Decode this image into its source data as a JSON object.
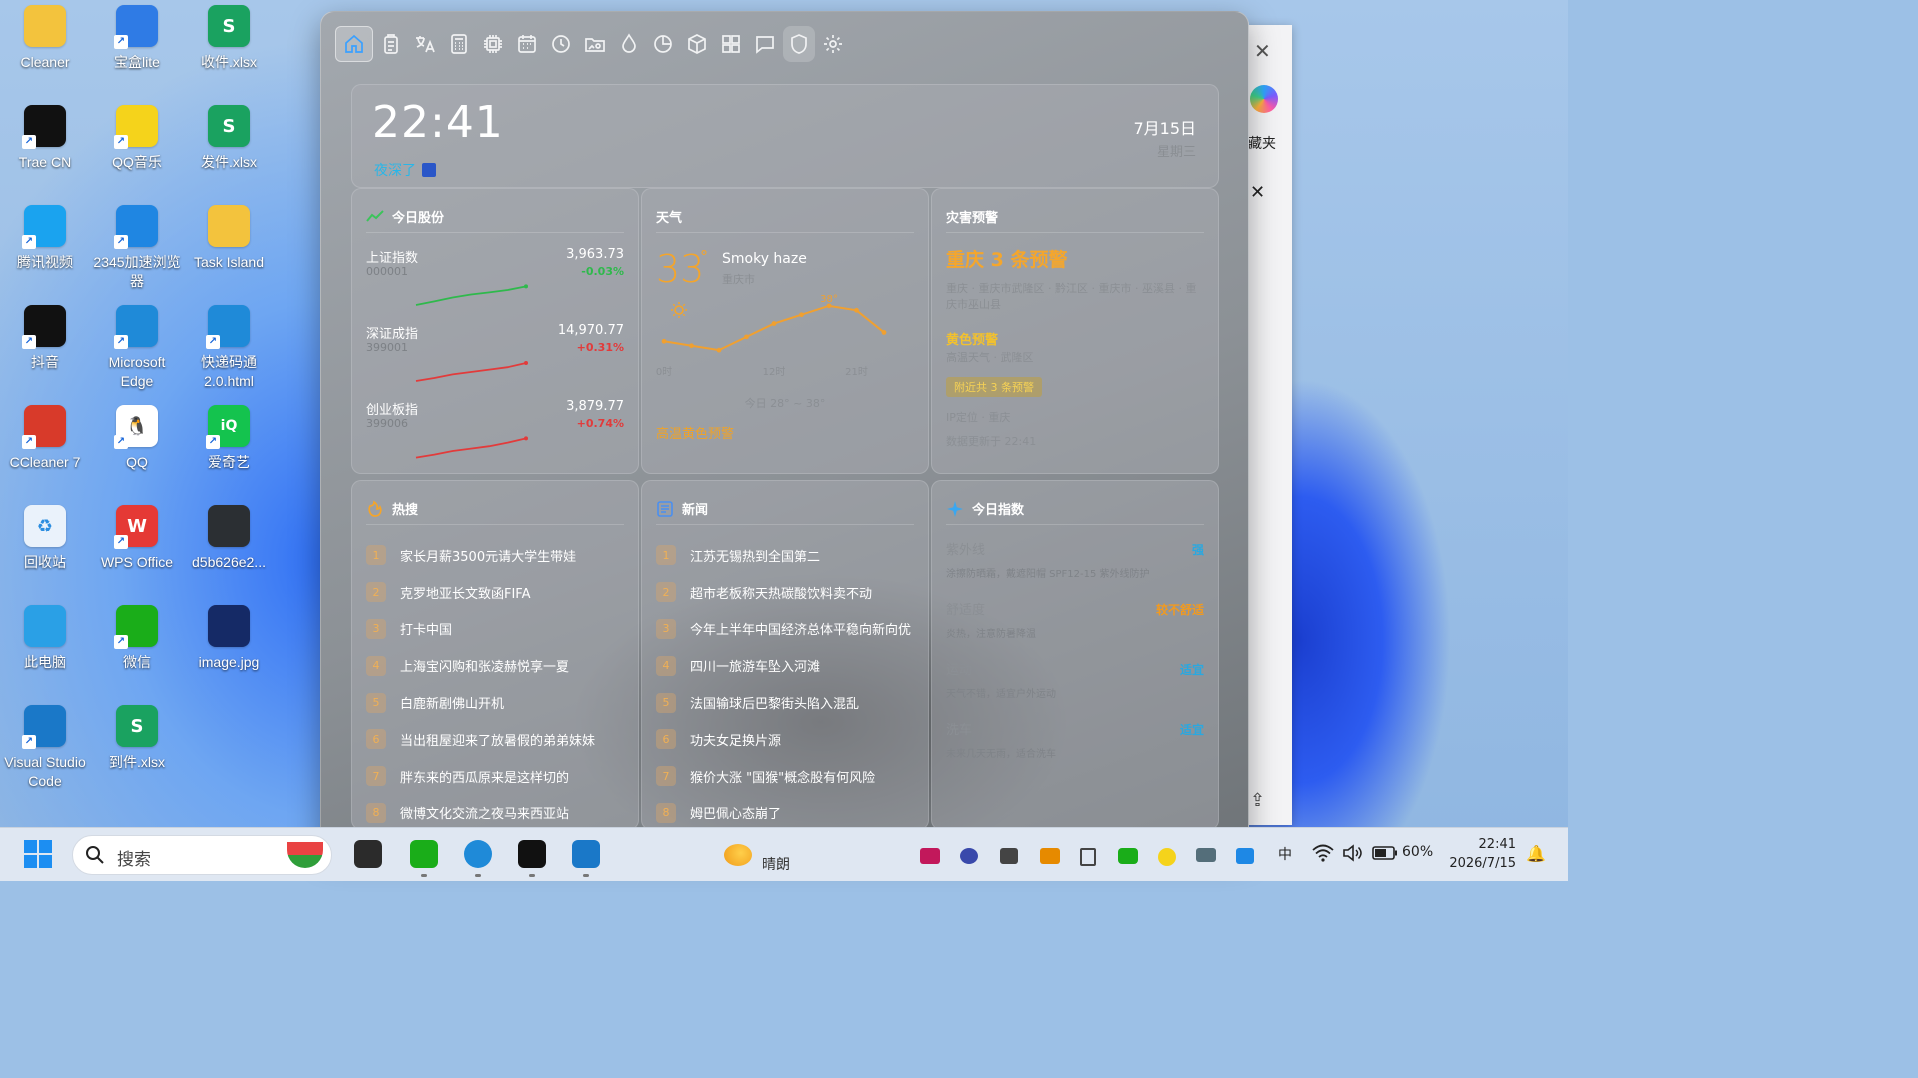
{
  "desktop": {
    "icons": [
      {
        "label": "Cleaner",
        "icon": "folder-icon",
        "color": "#f3c33d"
      },
      {
        "label": "宝盒lite",
        "icon": "shield-app-icon",
        "color": "#2f7be5"
      },
      {
        "label": "收件.xlsx",
        "icon": "spreadsheet-icon",
        "color": "#1aa260"
      },
      {
        "label": "Trae CN",
        "icon": "trae-icon",
        "color": "#111111"
      },
      {
        "label": "QQ音乐",
        "icon": "music-icon",
        "color": "#f5d31b"
      },
      {
        "label": "发件.xlsx",
        "icon": "spreadsheet-icon",
        "color": "#1aa260"
      },
      {
        "label": "腾讯视频",
        "icon": "video-play-icon",
        "color": "#1aa3ef"
      },
      {
        "label": "2345加速浏览器",
        "icon": "browser-icon",
        "color": "#1f86e2"
      },
      {
        "label": "Task Island",
        "icon": "folder-icon",
        "color": "#f3c33d"
      },
      {
        "label": "抖音",
        "icon": "tiktok-icon",
        "color": "#111111"
      },
      {
        "label": "Microsoft Edge",
        "icon": "edge-icon",
        "color": "#1f8ad8"
      },
      {
        "label": "快递码通2.0.html",
        "icon": "edge-icon",
        "color": "#1f8ad8"
      },
      {
        "label": "CCleaner 7",
        "icon": "ccleaner-icon",
        "color": "#d83a2a"
      },
      {
        "label": "QQ",
        "icon": "penguin-icon",
        "color": "#ffffff"
      },
      {
        "label": "爱奇艺",
        "icon": "iqiyi-icon",
        "color": "#14c34e"
      },
      {
        "label": "回收站",
        "icon": "recycle-bin-icon",
        "color": "#eaf2fb"
      },
      {
        "label": "WPS Office",
        "icon": "wps-icon",
        "color": "#e53935"
      },
      {
        "label": "d5b626e2...",
        "icon": "file-icon",
        "color": "#2b2f33"
      },
      {
        "label": "此电脑",
        "icon": "computer-icon",
        "color": "#2aa0e6"
      },
      {
        "label": "微信",
        "icon": "wechat-icon",
        "color": "#1aad19"
      },
      {
        "label": "image.jpg",
        "icon": "image-icon",
        "color": "#152a66"
      },
      {
        "label": "Visual Studio Code",
        "icon": "vscode-icon",
        "color": "#1a78c8"
      },
      {
        "label": "到件.xlsx",
        "icon": "spreadsheet-icon",
        "color": "#1aa260"
      }
    ]
  },
  "backwin": {
    "text": "藏夹"
  },
  "toolbar": {
    "icons": [
      "home-icon",
      "clipboard-icon",
      "translate-icon",
      "calculator-icon",
      "chip-icon",
      "calendar-icon",
      "clock-icon",
      "image-folder-icon",
      "water-drop-icon",
      "pie-chart-icon",
      "cube-icon",
      "grid-icon",
      "chat-icon",
      "shield-icon",
      "settings-icon"
    ]
  },
  "clock": {
    "time": "22:41",
    "greeting": "夜深了",
    "date": "7月15日",
    "weekday": "星期三"
  },
  "stocks": {
    "title": "今日股份",
    "items": [
      {
        "name": "上证指数",
        "code": "000001",
        "value": "3,963.73",
        "change": "-0.03%",
        "color": "#2fb94c",
        "trend": [
          0.2,
          0.32,
          0.45,
          0.55,
          0.62,
          0.7,
          0.82
        ]
      },
      {
        "name": "深证成指",
        "code": "399001",
        "value": "14,970.77",
        "change": "+0.31%",
        "color": "#e23b3b",
        "trend": [
          0.2,
          0.3,
          0.42,
          0.5,
          0.58,
          0.66,
          0.8
        ]
      },
      {
        "name": "创业板指",
        "code": "399006",
        "value": "3,879.77",
        "change": "+0.74%",
        "color": "#e23b3b",
        "trend": [
          0.18,
          0.28,
          0.4,
          0.48,
          0.56,
          0.68,
          0.82
        ]
      }
    ]
  },
  "weather": {
    "title": "天气",
    "temp": "33",
    "deg": "°",
    "condition": "Smoky haze",
    "city": "重庆市",
    "peak_label": "38°",
    "x_labels": [
      "0时",
      "12时",
      "21时"
    ],
    "hourly": [
      30,
      29,
      28,
      31,
      34,
      36,
      38,
      37,
      32
    ],
    "range": "今日 28° ~ 38°",
    "alert": "高温黄色预警"
  },
  "warning": {
    "title": "灾害预警",
    "headline": "重庆 3 条预警",
    "desc": "重庆 · 重庆市武隆区 · 黔江区 · 重庆市 · 巫溪县 · 重庆市巫山县",
    "level": "黄色预警",
    "level_sub": "高温天气 · 武隆区",
    "nearby": "附近共 3 条预警",
    "source": "IP定位 · 重庆",
    "updated": "数据更新于 22:41"
  },
  "hot": {
    "title": "热搜",
    "items": [
      "家长月薪3500元请大学生带娃",
      "克罗地亚长文致函FIFA",
      "打卡中国",
      "上海宝闪购和张凌赫悦享一夏",
      "白鹿新剧佛山开机",
      "当出租屋迎来了放暑假的弟弟妹妹",
      "胖东来的西瓜原来是这样切的",
      "微博文化交流之夜马来西亚站"
    ]
  },
  "news": {
    "title": "新闻",
    "items": [
      "江苏无锡热到全国第二",
      "超市老板称天热碳酸饮料卖不动",
      "今年上半年中国经济总体平稳向新向优",
      "四川一旅游车坠入河滩",
      "法国输球后巴黎街头陷入混乱",
      "功夫女足换片源",
      "猴价大涨 \"国猴\"概念股有何风险",
      "姆巴佩心态崩了"
    ]
  },
  "indices": {
    "title": "今日指数",
    "items": [
      {
        "name": "紫外线",
        "value": "强",
        "desc": "涂擦防晒霜，戴遮阳帽 SPF12-15 紫外线防护",
        "color": "#2aa8e0"
      },
      {
        "name": "舒适度",
        "value": "较不舒适",
        "desc": "炎热，注意防暑降温",
        "color": "#f29a1f"
      },
      {
        "name": "运动",
        "value": "适宜",
        "desc": "天气不错，适宜户外运动",
        "color": "#2aa8e0"
      },
      {
        "name": "洗车",
        "value": "适宜",
        "desc": "未来几天无雨，适合洗车",
        "color": "#2aa8e0"
      }
    ]
  },
  "taskbar": {
    "search_placeholder": "搜索",
    "weather": "晴朗",
    "ime": "中",
    "battery": "60%",
    "time": "22:41",
    "date": "2026/7/15"
  }
}
